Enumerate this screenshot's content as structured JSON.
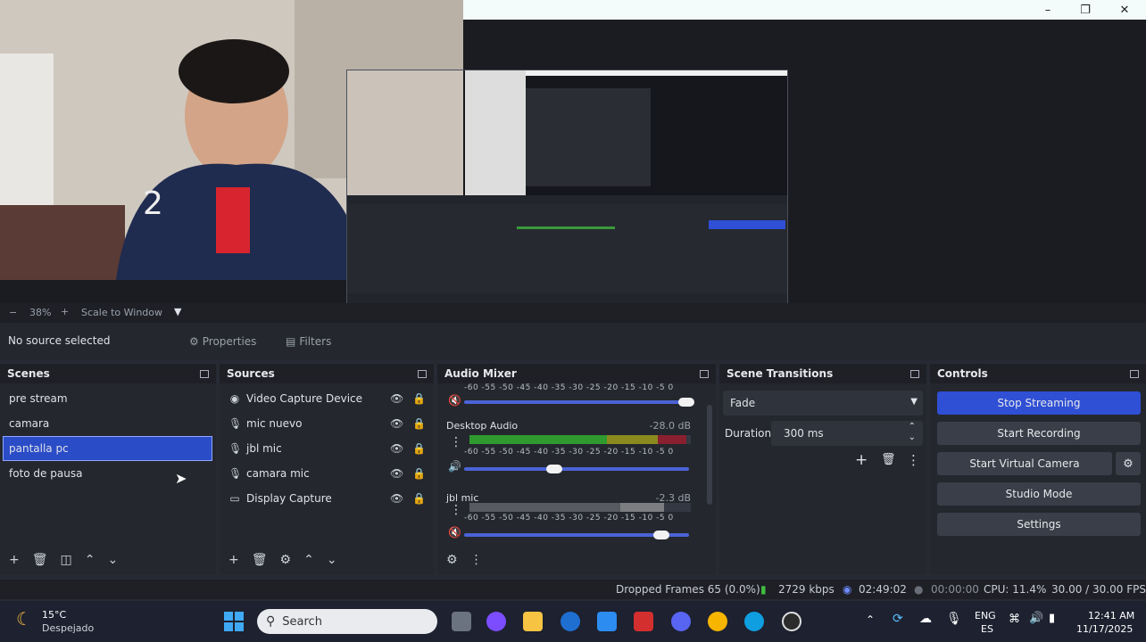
{
  "preview": {
    "zoom_minus": "−",
    "zoom_level": "38%",
    "zoom_plus": "+",
    "scale_mode": "Scale to Window"
  },
  "source_bar": {
    "selection_status": "No source selected",
    "properties_label": "Properties",
    "filters_label": "Filters"
  },
  "scenes": {
    "title": "Scenes",
    "items": [
      {
        "label": "pre stream"
      },
      {
        "label": "camara"
      },
      {
        "label": "pantalla pc"
      },
      {
        "label": "foto de pausa"
      }
    ],
    "selected_index": 2
  },
  "sources": {
    "title": "Sources",
    "items": [
      {
        "label": "Video Capture Device",
        "icon": "camera-icon"
      },
      {
        "label": "mic nuevo",
        "icon": "microphone-icon"
      },
      {
        "label": "jbl mic",
        "icon": "microphone-icon"
      },
      {
        "label": "camara mic",
        "icon": "microphone-icon"
      },
      {
        "label": "Display Capture",
        "icon": "monitor-icon"
      }
    ]
  },
  "audio_mixer": {
    "title": "Audio Mixer",
    "scale_text": "-60 -55 -50 -45 -40 -35 -30 -25 -20 -15 -10  -5  0",
    "channels": [
      {
        "name": "",
        "db": "",
        "volume": 1.0,
        "muted": true,
        "level": 0
      },
      {
        "name": "Desktop Audio",
        "db": "-28.0 dB",
        "volume": 0.4,
        "muted": false,
        "level": 0.98
      },
      {
        "name": "jbl mic",
        "db": "-2.3 dB",
        "volume": 0.88,
        "muted": true,
        "level": 0.9
      }
    ]
  },
  "scene_transitions": {
    "title": "Scene Transitions",
    "transition": "Fade",
    "duration_label": "Duration",
    "duration_value": "300 ms"
  },
  "controls": {
    "title": "Controls",
    "stop_streaming": "Stop Streaming",
    "start_recording": "Start Recording",
    "start_virtual_camera": "Start Virtual Camera",
    "studio_mode": "Studio Mode",
    "settings": "Settings"
  },
  "status_bar": {
    "dropped_frames": "Dropped Frames 65 (0.0%)",
    "bitrate": "2729 kbps",
    "stream_time": "02:49:02",
    "record_time": "00:00:00",
    "cpu": "CPU: 11.4%",
    "fps": "30.00 / 30.00 FPS"
  },
  "taskbar": {
    "weather_temp": "15°C",
    "weather_desc": "Despejado",
    "search_placeholder": "Search",
    "lang_line1": "ENG",
    "lang_line2": "ES",
    "time": "12:41 AM",
    "date": "11/17/2025"
  },
  "colors": {
    "accent": "#2f4fd4",
    "panel": "#24272e",
    "header": "#1e2026"
  }
}
